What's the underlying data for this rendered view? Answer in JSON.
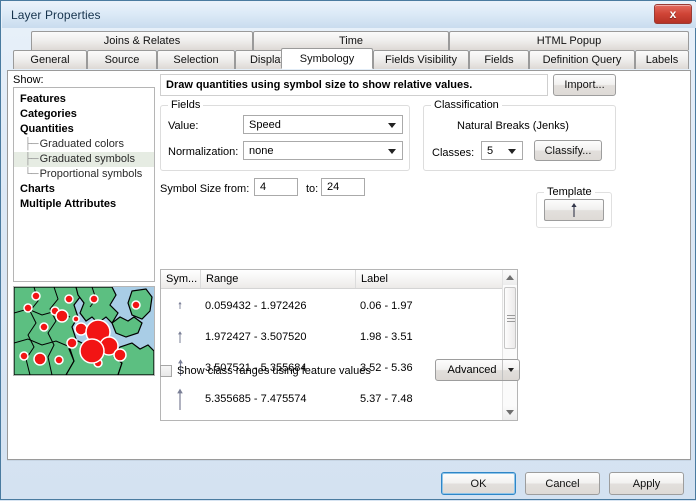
{
  "window": {
    "title": "Layer Properties",
    "close_label": "x"
  },
  "tabs": {
    "row1": [
      {
        "label": "Joins & Relates",
        "active": false
      },
      {
        "label": "Time",
        "active": false
      },
      {
        "label": "HTML Popup",
        "active": false
      }
    ],
    "row2": [
      {
        "label": "General",
        "active": false
      },
      {
        "label": "Source",
        "active": false
      },
      {
        "label": "Selection",
        "active": false
      },
      {
        "label": "Display",
        "active": false
      },
      {
        "label": "Symbology",
        "active": true
      },
      {
        "label": "Fields Visibility",
        "active": false
      },
      {
        "label": "Fields",
        "active": false
      },
      {
        "label": "Definition Query",
        "active": false
      },
      {
        "label": "Labels",
        "active": false
      }
    ]
  },
  "show": {
    "label": "Show:",
    "items": [
      {
        "label": "Features",
        "bold": true,
        "child": false,
        "selected": false
      },
      {
        "label": "Categories",
        "bold": true,
        "child": false,
        "selected": false
      },
      {
        "label": "Quantities",
        "bold": true,
        "child": false,
        "selected": false
      },
      {
        "label": "Graduated colors",
        "bold": false,
        "child": true,
        "selected": false
      },
      {
        "label": "Graduated symbols",
        "bold": false,
        "child": true,
        "selected": true
      },
      {
        "label": "Proportional symbols",
        "bold": false,
        "child": true,
        "selected": false
      },
      {
        "label": "Charts",
        "bold": true,
        "child": false,
        "selected": false
      },
      {
        "label": "Multiple Attributes",
        "bold": true,
        "child": false,
        "selected": false
      }
    ]
  },
  "map_preview": {
    "land_color": "#5cbf81",
    "water_color": "#a9cde6",
    "symbol_color": "#f21414",
    "outline_color": "#000000"
  },
  "description": "Draw quantities using symbol size to show relative values.",
  "import_button": "Import...",
  "fields": {
    "title": "Fields",
    "value_label": "Value:",
    "value_selected": "Speed",
    "normalization_label": "Normalization:",
    "normalization_selected": "none"
  },
  "classification": {
    "title": "Classification",
    "method": "Natural Breaks (Jenks)",
    "classes_label": "Classes:",
    "classes_value": "5",
    "classify_button": "Classify..."
  },
  "symbol_size": {
    "from_label": "Symbol Size from:",
    "from_value": "4",
    "to_label": "to:",
    "to_value": "24"
  },
  "template": {
    "title": "Template",
    "symbol_name": "arrow-symbol"
  },
  "table": {
    "columns": [
      "Sym...",
      "Range",
      "Label"
    ],
    "rows": [
      {
        "symbol_size": 1,
        "range": "0.059432 - 1.972426",
        "label": "0.06 - 1.97"
      },
      {
        "symbol_size": 2,
        "range": "1.972427 - 3.507520",
        "label": "1.98 - 3.51"
      },
      {
        "symbol_size": 3,
        "range": "3.507521 - 5.355684",
        "label": "3.52 - 5.36"
      },
      {
        "symbol_size": 4,
        "range": "5.355685 - 7.475574",
        "label": "5.37 - 7.48"
      }
    ]
  },
  "show_class_ranges": {
    "label": "Show class ranges using feature values",
    "checked": false
  },
  "advanced_button": "Advanced",
  "footer": {
    "ok": "OK",
    "cancel": "Cancel",
    "apply": "Apply"
  }
}
